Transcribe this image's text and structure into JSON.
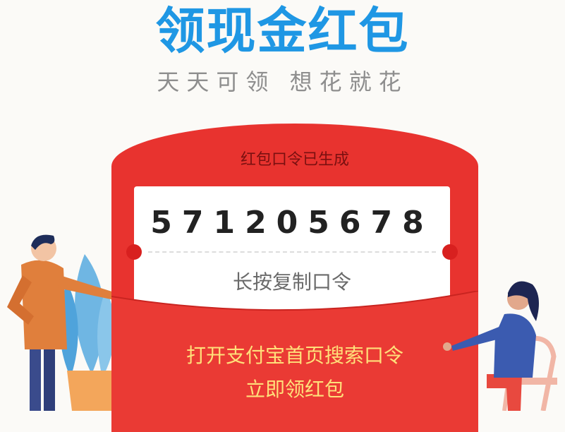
{
  "header": {
    "title": "领现金红包",
    "subtitle": "天天可领  想花就花"
  },
  "envelope": {
    "heading": "红包口令已生成",
    "code": "571205678",
    "copy_hint": "长按复制口令",
    "instruction_line1": "打开支付宝首页搜索口令",
    "instruction_line2": "立即领红包"
  },
  "colors": {
    "title_blue": "#1f97e4",
    "envelope_red": "#e8332f",
    "instruction_yellow": "#ffe07a"
  },
  "illustrations": {
    "left": "man-pointing-with-plant-illustration",
    "right": "woman-sitting-on-chair-illustration"
  }
}
